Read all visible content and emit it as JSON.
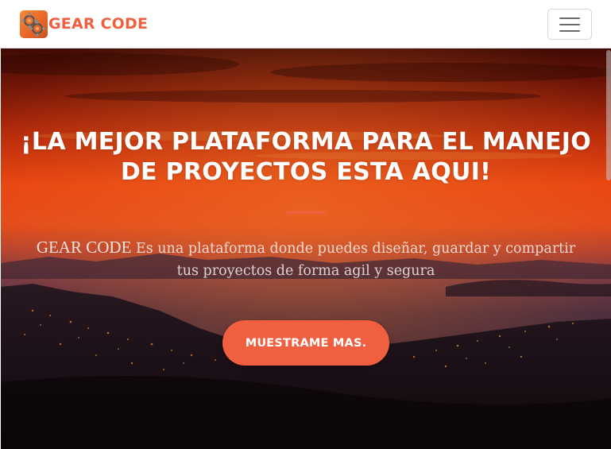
{
  "navbar": {
    "brand_text": "GEAR CODE",
    "brand_logo_icon": "gear-code-logo-icon",
    "menu_icon": "hamburger-menu-icon"
  },
  "hero": {
    "title": "¡LA MEJOR PLATAFORMA PARA EL MANEJO DE PROYECTOS ESTA AQUI!",
    "lead_brand": "GEAR CODE",
    "lead_text": " Es una plataforma donde puedes diseñar, guardar y compartir tus proyectos de forma agil y segura",
    "cta_label": "MUESTRAME MAS."
  },
  "colors": {
    "accent": "#f05f40",
    "navbar_bg": "#ffffff",
    "hero_sky_top": "#5a1208",
    "hero_sky_glow": "#ff4a10",
    "hero_sea": "#3a1f2e"
  }
}
